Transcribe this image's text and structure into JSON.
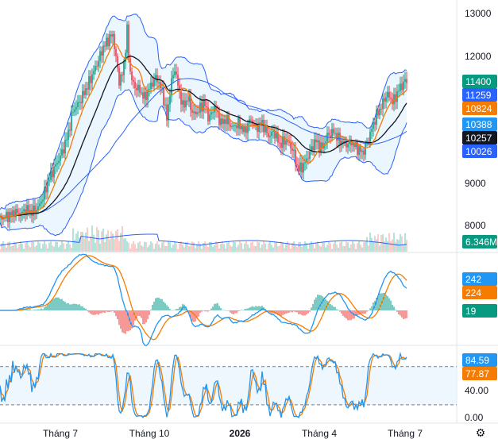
{
  "chart_data": [
    {
      "type": "candlestick",
      "title": "",
      "ylim": [
        7850,
        13300
      ],
      "yticks": [
        8000,
        9000,
        10000,
        11000,
        12000,
        13000
      ],
      "colors": {
        "up": "#089981",
        "down": "#f23645",
        "ma_fast": "#f57c00",
        "ma_slow": "#131722",
        "band": "#2962ff",
        "band_fill": "#e3f2fd",
        "ma_long": "#2962ff"
      },
      "x_labels": [
        "Tháng 7",
        "Tháng 10",
        "2026",
        "Tháng 4",
        "Tháng 7"
      ],
      "close_path": [
        [
          0,
          8150
        ],
        [
          10,
          8200
        ],
        [
          18,
          8300
        ],
        [
          25,
          8250
        ],
        [
          32,
          8350
        ],
        [
          40,
          8300
        ],
        [
          48,
          8400
        ],
        [
          55,
          8700
        ],
        [
          62,
          9100
        ],
        [
          70,
          9400
        ],
        [
          78,
          9700
        ],
        [
          85,
          10100
        ],
        [
          92,
          10700
        ],
        [
          100,
          10900
        ],
        [
          108,
          11200
        ],
        [
          115,
          11500
        ],
        [
          122,
          11800
        ],
        [
          130,
          12200
        ],
        [
          137,
          12400
        ],
        [
          142,
          12500
        ],
        [
          147,
          11800
        ],
        [
          150,
          11400
        ],
        [
          155,
          11600
        ],
        [
          160,
          12600
        ],
        [
          163,
          11700
        ],
        [
          168,
          11300
        ],
        [
          175,
          11200
        ],
        [
          182,
          11000
        ],
        [
          190,
          11300
        ],
        [
          197,
          11500
        ],
        [
          205,
          11100
        ],
        [
          210,
          10500
        ],
        [
          215,
          11300
        ],
        [
          220,
          11700
        ],
        [
          225,
          11200
        ],
        [
          230,
          10800
        ],
        [
          237,
          11000
        ],
        [
          243,
          10600
        ],
        [
          250,
          10700
        ],
        [
          257,
          10900
        ],
        [
          263,
          10500
        ],
        [
          270,
          10800
        ],
        [
          278,
          10400
        ],
        [
          285,
          10500
        ],
        [
          292,
          10300
        ],
        [
          300,
          10400
        ],
        [
          308,
          10200
        ],
        [
          315,
          10500
        ],
        [
          322,
          10300
        ],
        [
          330,
          10400
        ],
        [
          338,
          10100
        ],
        [
          345,
          10200
        ],
        [
          352,
          9900
        ],
        [
          360,
          10000
        ],
        [
          368,
          9800
        ],
        [
          375,
          9300
        ],
        [
          382,
          9400
        ],
        [
          390,
          9700
        ],
        [
          397,
          10000
        ],
        [
          405,
          9800
        ],
        [
          412,
          10100
        ],
        [
          420,
          10200
        ],
        [
          427,
          10000
        ],
        [
          435,
          9900
        ],
        [
          442,
          9950
        ],
        [
          450,
          9800
        ],
        [
          457,
          9700
        ],
        [
          465,
          10100
        ],
        [
          472,
          10500
        ],
        [
          480,
          10800
        ],
        [
          487,
          11100
        ],
        [
          495,
          10900
        ],
        [
          502,
          11200
        ],
        [
          510,
          11400
        ]
      ],
      "volume": {
        "label": "6.346M",
        "ylim": [
          0,
          14000000
        ],
        "last": 6346000
      },
      "indicators": {
        "ma_fast_last": 10824,
        "ma_slow_last": 10257,
        "band_upper_last": 11259,
        "band_lower_last": 10026,
        "ma_long_last": 10388,
        "last_price": 11400
      }
    },
    {
      "type": "line",
      "title": "",
      "series": [
        {
          "values": [
            242
          ]
        },
        {
          "values": [
            224
          ]
        },
        {
          "values": [
            19
          ]
        }
      ],
      "last_values": [
        242,
        224,
        19
      ]
    },
    {
      "type": "line",
      "title": "",
      "ylim": [
        0,
        100
      ],
      "yticks": [
        0,
        40,
        84.59
      ],
      "ytick_labels": [
        "0.00",
        "40.00",
        "84.59"
      ],
      "bands": [
        20,
        80
      ],
      "last_values": [
        84.59,
        77.87
      ]
    }
  ],
  "badges": {
    "price": "11400",
    "band_upper": "11259",
    "ma_fast": "10824",
    "ma_long": "10388",
    "ma_slow": "10257",
    "band_lower": "10026",
    "volume": "6.346M",
    "macd": "242",
    "macd_signal": "224",
    "macd_hist": "19",
    "stoch_k": "84.59",
    "stoch_d": "77.87"
  },
  "y_axis": {
    "price_ticks": [
      "13000",
      "12000",
      "11000",
      "10000",
      "9000",
      "8000"
    ],
    "stoch_ticks": [
      "40.00",
      "0.00"
    ]
  },
  "settings_icon": "gear-icon"
}
